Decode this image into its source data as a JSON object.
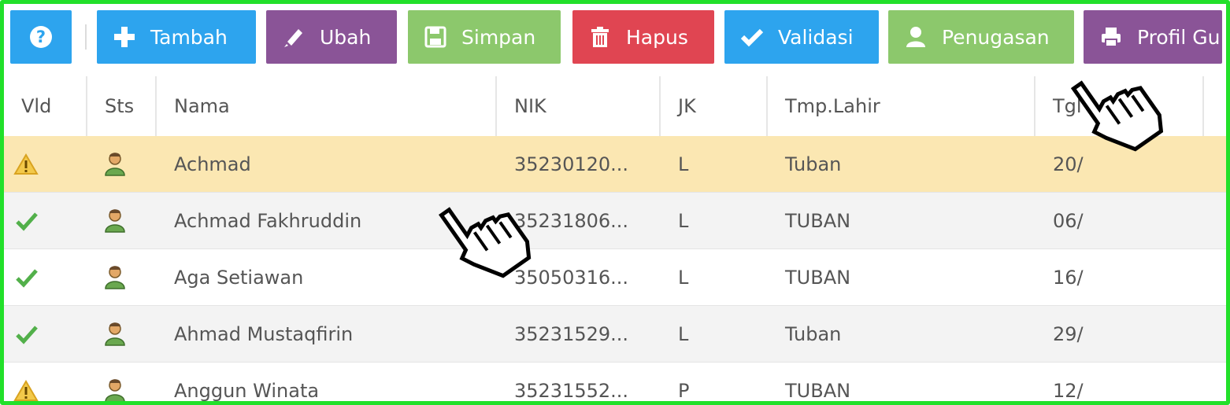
{
  "toolbar": {
    "help_glyph": "?",
    "buttons": [
      {
        "label": "Tambah",
        "color": "#2da4ee",
        "icon": "plus-icon"
      },
      {
        "label": "Ubah",
        "color": "#8a5497",
        "icon": "pencil-icon"
      },
      {
        "label": "Simpan",
        "color": "#8cc86c",
        "icon": "save-icon"
      },
      {
        "label": "Hapus",
        "color": "#e04552",
        "icon": "trash-icon"
      },
      {
        "label": "Validasi",
        "color": "#2da4ee",
        "icon": "check-icon"
      },
      {
        "label": "Penugasan",
        "color": "#8cc86c",
        "icon": "user-icon"
      },
      {
        "label": "Profil Gu",
        "color": "#8a5497",
        "icon": "print-icon"
      }
    ]
  },
  "table": {
    "headers": [
      "Vld",
      "Sts",
      "Nama",
      "NIK",
      "JK",
      "Tmp.Lahir",
      "Tgl"
    ],
    "rows": [
      {
        "vld": "warning",
        "nama": "Achmad",
        "nik": "35230120...",
        "jk": "L",
        "tmp_lahir": "Tuban",
        "tgl": "20/"
      },
      {
        "vld": "valid",
        "nama": "Achmad Fakhruddin",
        "nik": "35231806...",
        "jk": "L",
        "tmp_lahir": "TUBAN",
        "tgl": "06/"
      },
      {
        "vld": "valid",
        "nama": "Aga Setiawan",
        "nik": "35050316...",
        "jk": "L",
        "tmp_lahir": "TUBAN",
        "tgl": "16/"
      },
      {
        "vld": "valid",
        "nama": "Ahmad Mustaqfirin",
        "nik": "35231529...",
        "jk": "L",
        "tmp_lahir": "Tuban",
        "tgl": "29/"
      },
      {
        "vld": "warning",
        "nama": "Anggun Winata",
        "nik": "35231552...",
        "jk": "P",
        "tmp_lahir": "TUBAN",
        "tgl": "12/"
      }
    ]
  },
  "colors": {
    "frame": "#22e02a",
    "selected_row": "#fbe7b2",
    "alt_row": "#f3f3f3"
  }
}
